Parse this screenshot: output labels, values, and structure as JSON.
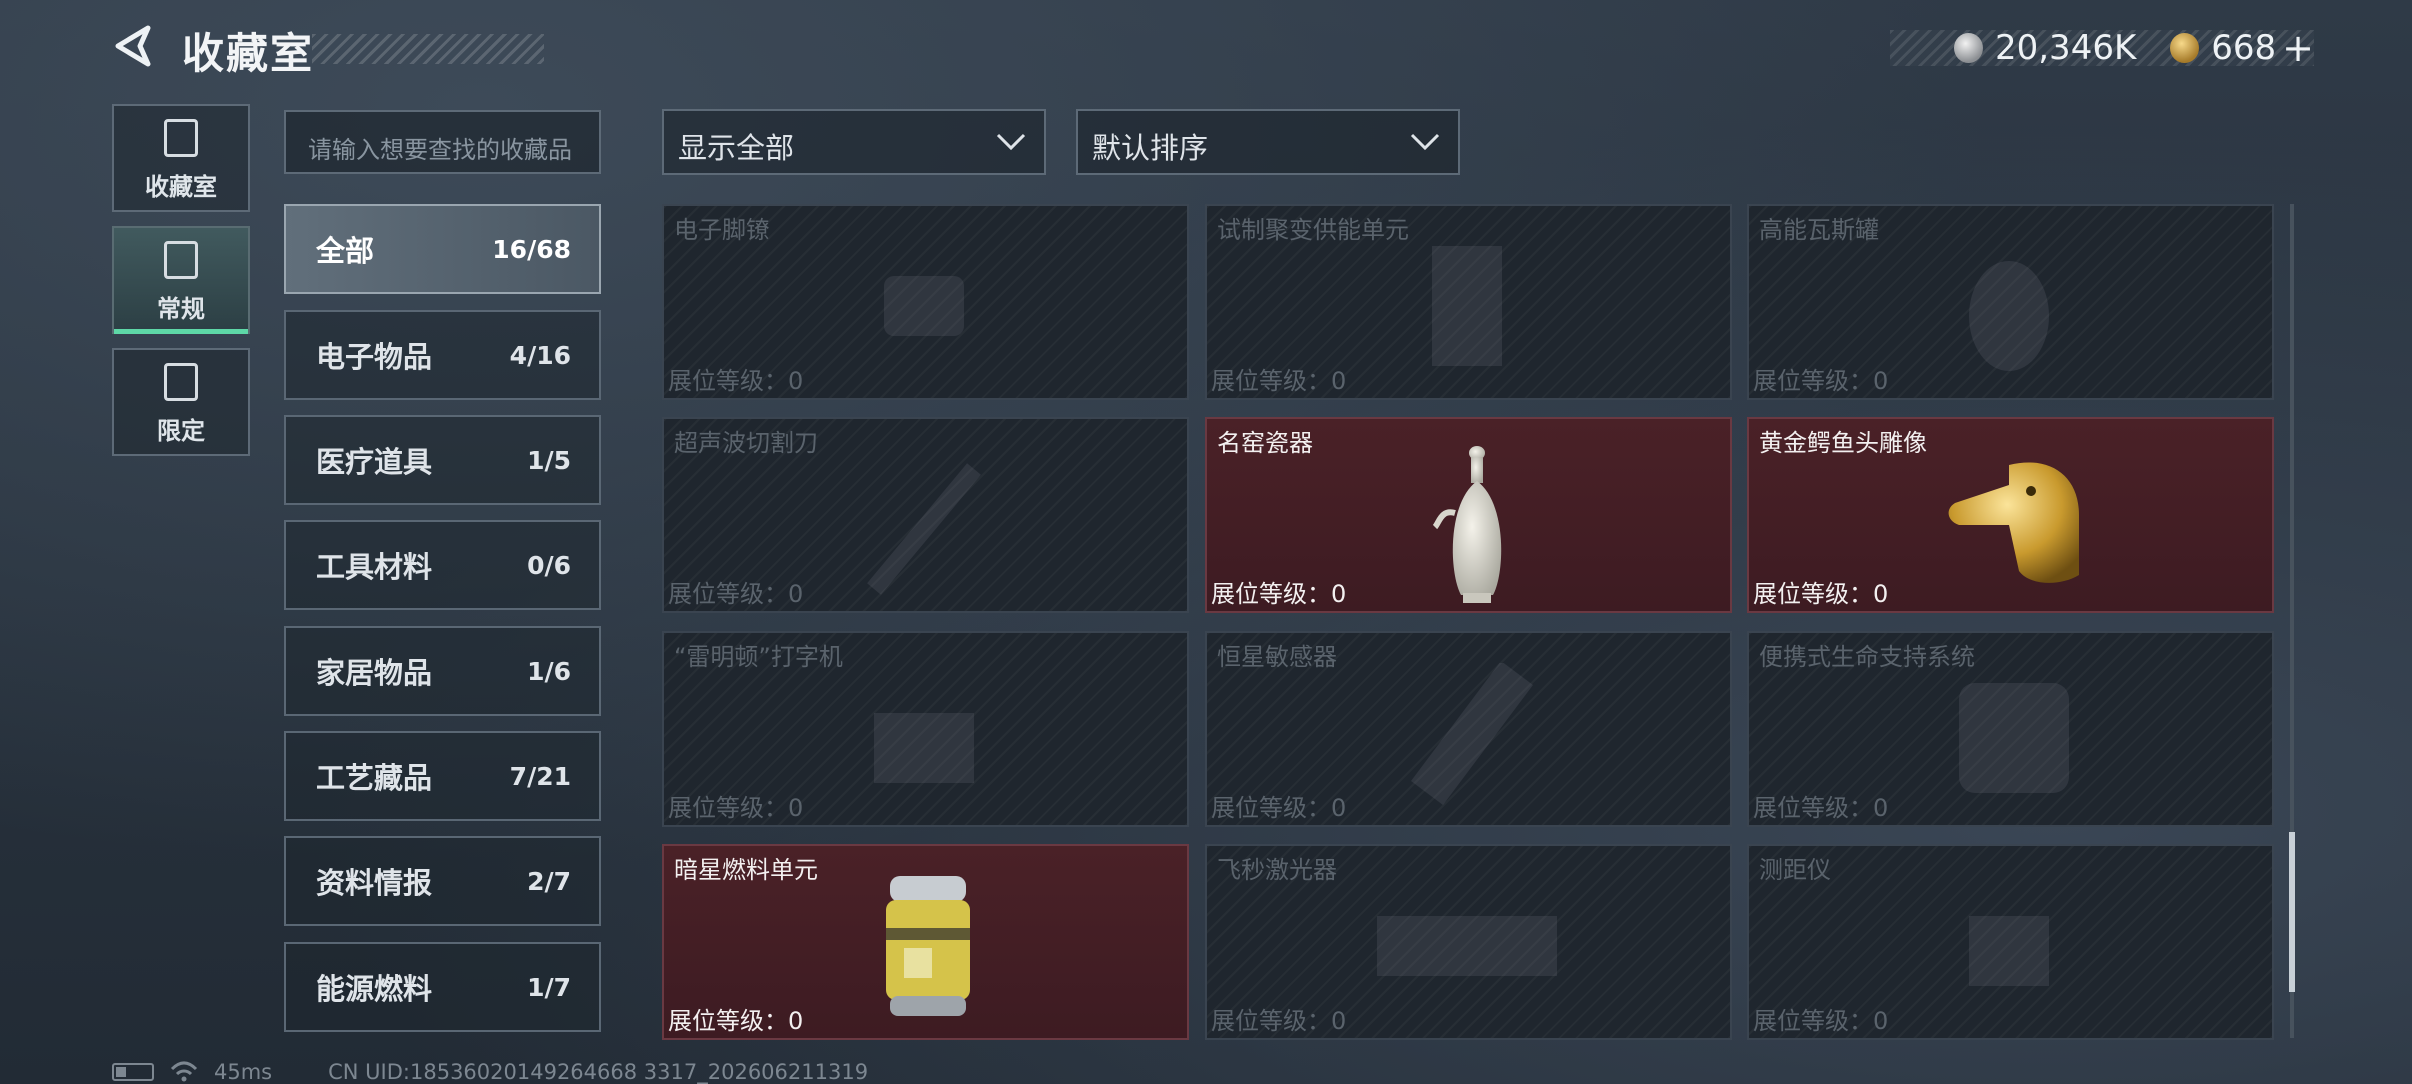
{
  "header": {
    "title": "收藏室",
    "currency": [
      {
        "icon": "silver-coin-icon",
        "value": "20,346K"
      },
      {
        "icon": "gold-coin-icon",
        "value": "668"
      }
    ],
    "add_label": "+"
  },
  "rail": {
    "items": [
      {
        "label": "收藏室",
        "icon": "collection-room-icon"
      },
      {
        "label": "常规",
        "icon": "regular-icon",
        "active": true
      },
      {
        "label": "限定",
        "icon": "limited-icon"
      }
    ]
  },
  "search": {
    "placeholder": "请输入想要查找的收藏品"
  },
  "categories": [
    {
      "name": "全部",
      "count": "16/68",
      "active": true
    },
    {
      "name": "电子物品",
      "count": "4/16"
    },
    {
      "name": "医疗道具",
      "count": "1/5"
    },
    {
      "name": "工具材料",
      "count": "0/6"
    },
    {
      "name": "家居物品",
      "count": "1/6"
    },
    {
      "name": "工艺藏品",
      "count": "7/21"
    },
    {
      "name": "资料情报",
      "count": "2/7"
    },
    {
      "name": "能源燃料",
      "count": "1/7"
    }
  ],
  "filters": {
    "display": "显示全部",
    "sort": "默认排序"
  },
  "items": [
    {
      "name": "电子脚镣",
      "level": "展位等级：0",
      "owned": false
    },
    {
      "name": "试制聚变供能单元",
      "level": "展位等级：0",
      "owned": false
    },
    {
      "name": "高能瓦斯罐",
      "level": "展位等级：0",
      "owned": false
    },
    {
      "name": "超声波切割刀",
      "level": "展位等级：0",
      "owned": false
    },
    {
      "name": "名窑瓷器",
      "level": "展位等级：0",
      "owned": true
    },
    {
      "name": "黄金鳄鱼头雕像",
      "level": "展位等级：0",
      "owned": true
    },
    {
      "name": "“雷明顿”打字机",
      "level": "展位等级：0",
      "owned": false
    },
    {
      "name": "恒星敏感器",
      "level": "展位等级：0",
      "owned": false
    },
    {
      "name": "便携式生命支持系统",
      "level": "展位等级：0",
      "owned": false
    },
    {
      "name": "暗星燃料单元",
      "level": "展位等级：0",
      "owned": true
    },
    {
      "name": "飞秒激光器",
      "level": "展位等级：0",
      "owned": false
    },
    {
      "name": "测距仪",
      "level": "展位等级：0",
      "owned": false
    }
  ],
  "status": {
    "ping": "45ms",
    "uid": "CN UID:18536020149264668 3317_202606211319"
  },
  "colors": {
    "accent_green": "#5ed8a7",
    "owned_card": "#4a2127"
  }
}
